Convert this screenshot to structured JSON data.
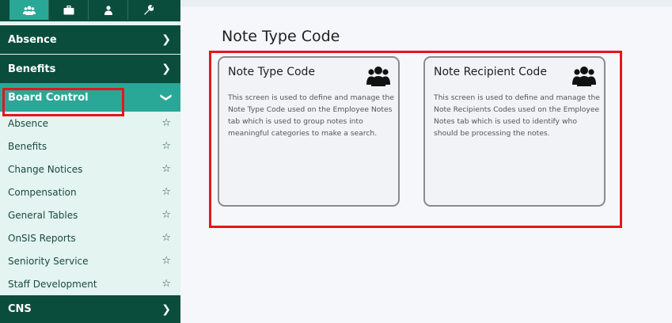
{
  "sidebar": {
    "icon_tabs": [
      {
        "icon": "people-icon"
      },
      {
        "icon": "briefcase-icon"
      },
      {
        "icon": "person-icon"
      },
      {
        "icon": "wrench-icon"
      }
    ],
    "sections": [
      {
        "label": "Absence",
        "state": "collapsed"
      },
      {
        "label": "Benefits",
        "state": "collapsed"
      },
      {
        "label": "Board Control",
        "state": "expanded"
      },
      {
        "label": "CNS",
        "state": "collapsed"
      }
    ],
    "board_control_items": [
      {
        "label": "Absence"
      },
      {
        "label": "Benefits"
      },
      {
        "label": "Change Notices"
      },
      {
        "label": "Compensation"
      },
      {
        "label": "General Tables"
      },
      {
        "label": "OnSIS Reports"
      },
      {
        "label": "Seniority Service"
      },
      {
        "label": "Staff Development"
      }
    ]
  },
  "main": {
    "title": "Note Type Code",
    "cards": [
      {
        "title": "Note Type Code",
        "icon": "people-icon",
        "description": "This screen is used to define and manage the Note Type Code used on the Employee Notes tab which is used to group notes into meaningful categories to make a search."
      },
      {
        "title": "Note Recipient Code",
        "icon": "people-icon",
        "description": "This screen is used to define and manage the Note Recipients Codes used on the Employee Notes tab which is used to identify who should be processing the notes."
      }
    ]
  },
  "colors": {
    "sidebar_dark": "#0a4d3c",
    "sidebar_active": "#2aa897",
    "sidebar_light": "#e3f4f1",
    "highlight_red": "#e3161d"
  }
}
